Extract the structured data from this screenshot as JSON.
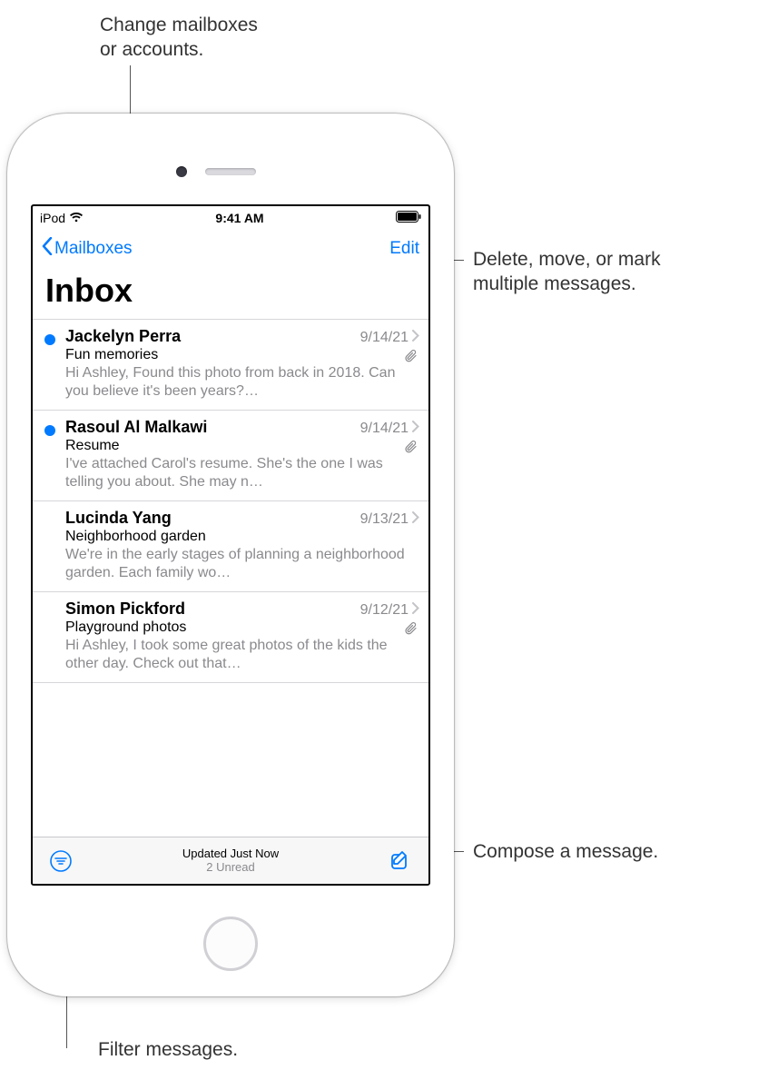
{
  "callouts": {
    "top": "Change mailboxes\nor accounts.",
    "edit": "Delete, move, or mark\nmultiple messages.",
    "compose": "Compose a message.",
    "filter": "Filter messages."
  },
  "status": {
    "carrier": "iPod",
    "time": "9:41 AM"
  },
  "nav": {
    "back_label": "Mailboxes",
    "edit_label": "Edit"
  },
  "title": "Inbox",
  "messages": [
    {
      "sender": "Jackelyn Perra",
      "date": "9/14/21",
      "subject": "Fun memories",
      "preview": "Hi Ashley, Found this photo from back in 2018. Can you believe it's been years?…",
      "unread": true,
      "attachment": true
    },
    {
      "sender": "Rasoul Al Malkawi",
      "date": "9/14/21",
      "subject": "Resume",
      "preview": "I've attached Carol's resume. She's the one I was telling you about. She may n…",
      "unread": true,
      "attachment": true
    },
    {
      "sender": "Lucinda Yang",
      "date": "9/13/21",
      "subject": "Neighborhood garden",
      "preview": "We're in the early stages of planning a neighborhood garden. Each family wo…",
      "unread": false,
      "attachment": false
    },
    {
      "sender": "Simon Pickford",
      "date": "9/12/21",
      "subject": "Playground photos",
      "preview": "Hi Ashley, I took some great photos of the kids the other day. Check out that…",
      "unread": false,
      "attachment": true
    }
  ],
  "toolbar": {
    "status_line1": "Updated Just Now",
    "status_line2": "2 Unread"
  }
}
